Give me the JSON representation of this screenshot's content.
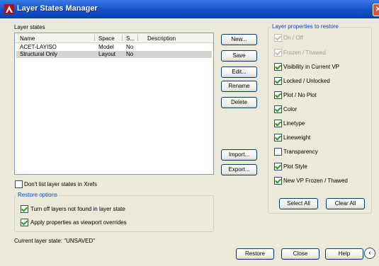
{
  "window": {
    "title": "Layer States Manager"
  },
  "states_section": {
    "label": "Layer states"
  },
  "list": {
    "headers": [
      "Name",
      "Space",
      "S...",
      "Description"
    ],
    "rows": [
      [
        "ACET-LAYISO",
        "Model",
        "No",
        ""
      ],
      [
        "Structural Only",
        "Layout",
        "No",
        ""
      ]
    ]
  },
  "buttons": {
    "new": "New...",
    "save": "Save",
    "edit": "Edit...",
    "rename": "Rename",
    "delete": "Delete",
    "import": "Import...",
    "export": "Export...",
    "select_all": "Select All",
    "clear_all": "Clear All",
    "restore": "Restore",
    "close": "Close",
    "help": "Help"
  },
  "xrefs_option": {
    "label": "Don't list layer states in Xrefs",
    "checked": false
  },
  "restore_options": {
    "title": "Restore options",
    "items": [
      {
        "label": "Turn off layers not found in layer state",
        "checked": true
      },
      {
        "label": "Apply properties as viewport overrides",
        "checked": true
      }
    ]
  },
  "current_state": "Current layer state: \"UNSAVED\"",
  "properties": {
    "title": "Layer properties to restore",
    "items": [
      {
        "label": "On / Off",
        "checked": true,
        "disabled": true
      },
      {
        "label": "Frozen / Thawed",
        "checked": true,
        "disabled": true
      },
      {
        "label": "Visibility in Current VP",
        "checked": true,
        "disabled": false
      },
      {
        "label": "Locked / Unlocked",
        "checked": true,
        "disabled": false
      },
      {
        "label": "Plot / No Plot",
        "checked": true,
        "disabled": false
      },
      {
        "label": "Color",
        "checked": true,
        "disabled": false
      },
      {
        "label": "Linetype",
        "checked": true,
        "disabled": false
      },
      {
        "label": "Lineweight",
        "checked": true,
        "disabled": false
      },
      {
        "label": "Transparency",
        "checked": false,
        "disabled": false
      },
      {
        "label": "Plot Style",
        "checked": true,
        "disabled": false
      },
      {
        "label": "New VP Frozen / Thawed",
        "checked": true,
        "disabled": false
      }
    ]
  },
  "icons": {
    "app": "autocad-logo-icon",
    "close": "close-icon",
    "collapse": "chevron-left-icon"
  }
}
